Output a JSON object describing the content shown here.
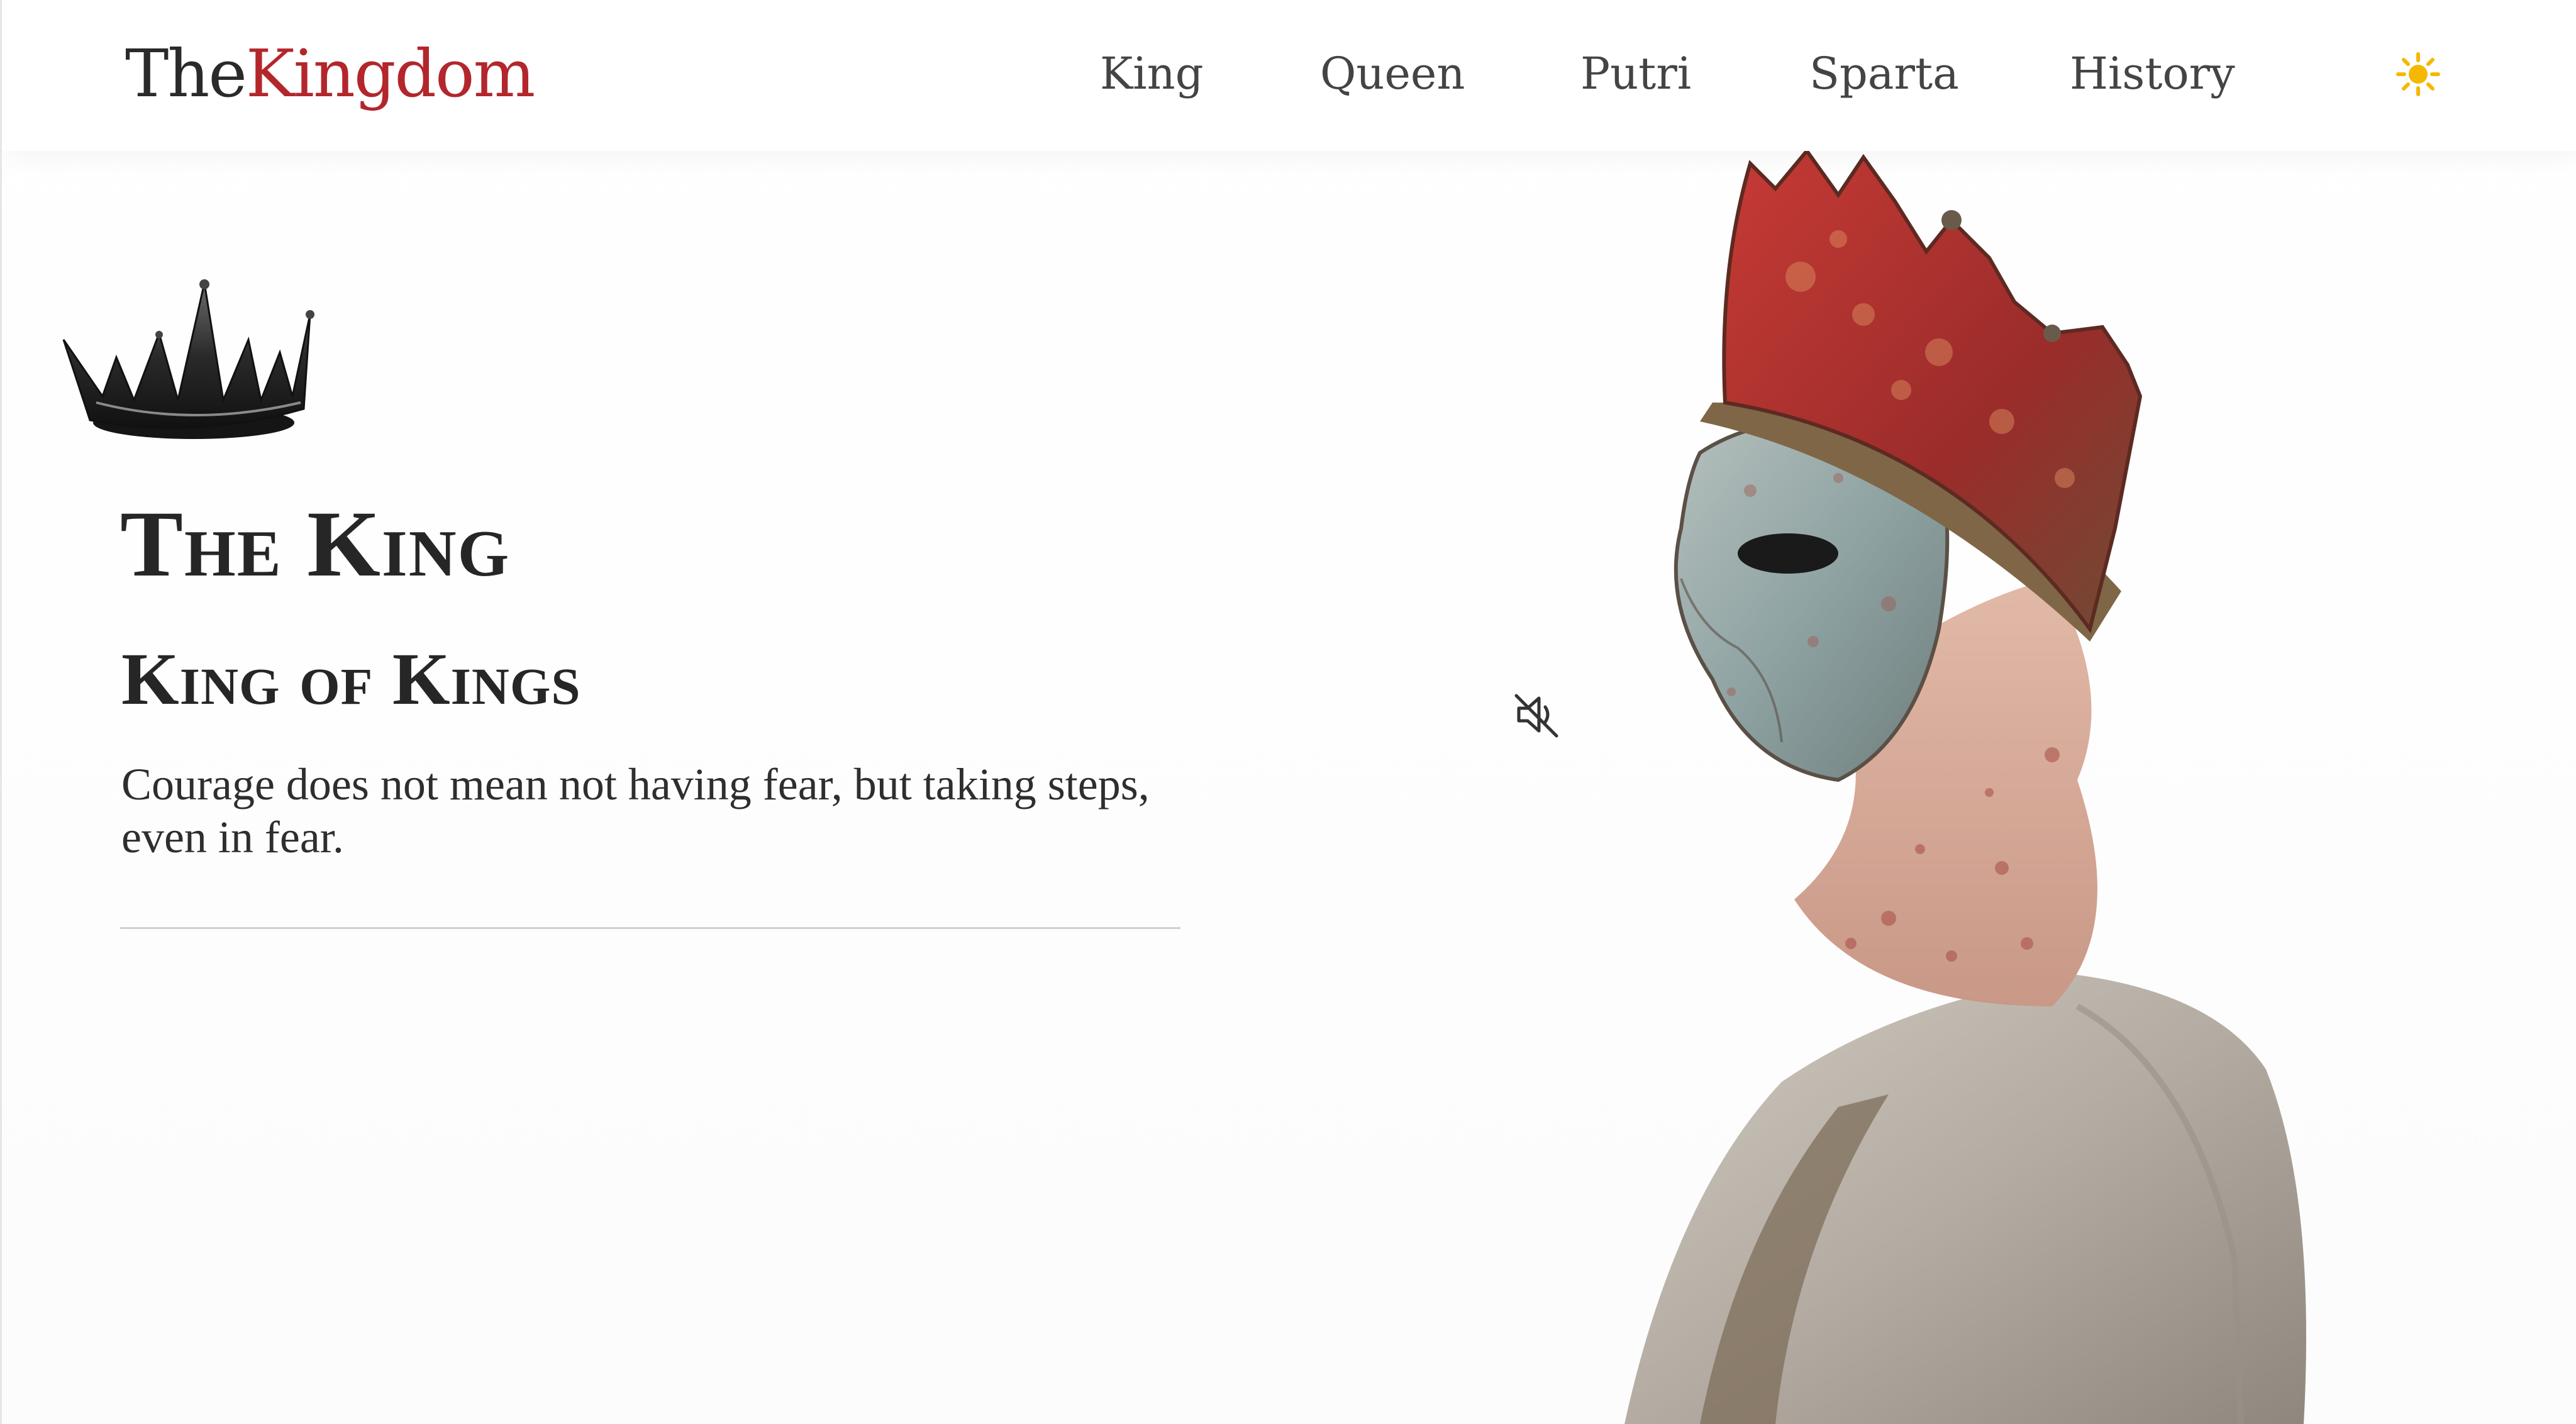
{
  "logo": {
    "the": "The",
    "kingdom": "Kingdom"
  },
  "nav": {
    "items": [
      {
        "label": "King"
      },
      {
        "label": "Queen"
      },
      {
        "label": "Putri"
      },
      {
        "label": "Sparta"
      },
      {
        "label": "History"
      }
    ],
    "theme_icon": "sun-icon"
  },
  "hero": {
    "title": "The King",
    "subtitle": "King of Kings",
    "quote": "Courage does not mean not having fear, but taking steps, even in fear.",
    "sound_icon": "speaker-muted-icon",
    "image": "masked-king-figure"
  },
  "colors": {
    "brand_red": "#b3262b",
    "text_dark": "#262626",
    "sun_yellow": "#f5b800"
  }
}
